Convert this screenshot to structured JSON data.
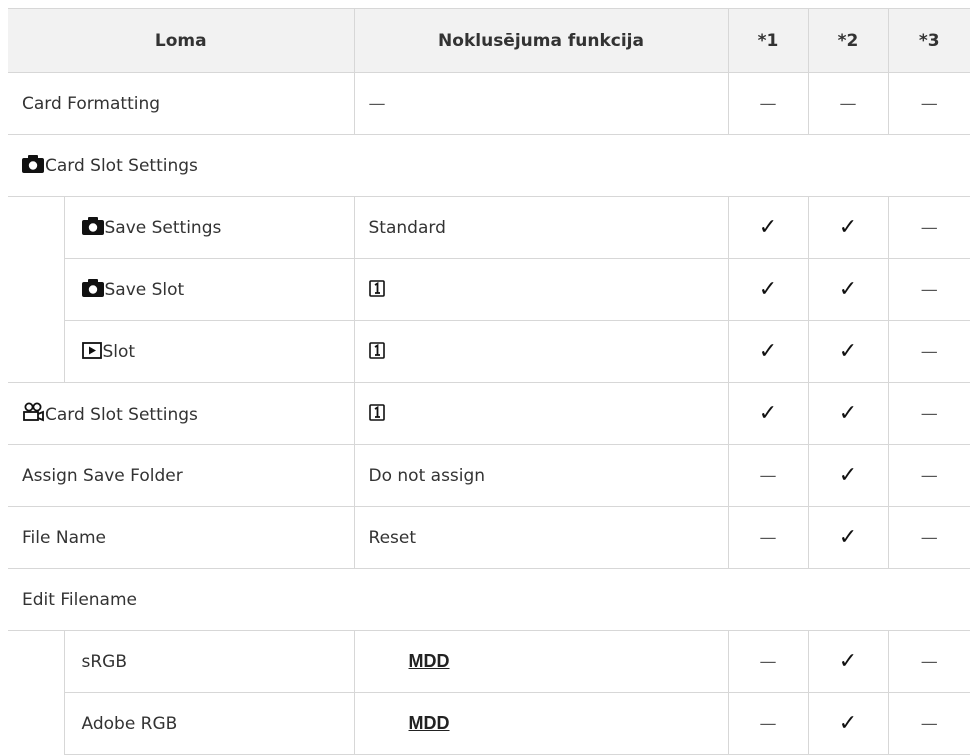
{
  "headers": [
    "Loma",
    "Noklusējuma funkcija",
    "*1",
    "*2",
    "*3"
  ],
  "rows": [
    {
      "label": "Card Formatting",
      "icon": "",
      "level": 0,
      "value": "—",
      "c1": "—",
      "c2": "—",
      "c3": "—"
    },
    {
      "label": "Card Slot Settings",
      "icon": "camera-icon",
      "level": 0,
      "section": true
    },
    {
      "label": "Save Settings",
      "icon": "camera-icon",
      "level": 1,
      "value": "Standard",
      "c1": "✓",
      "c2": "✓",
      "c3": "—"
    },
    {
      "label": "Save Slot",
      "icon": "camera-icon",
      "level": 1,
      "value": "card-slot-1-icon",
      "c1": "✓",
      "c2": "✓",
      "c3": "—"
    },
    {
      "label": "Slot",
      "icon": "playback-icon",
      "level": 1,
      "value": "card-slot-1-icon",
      "c1": "✓",
      "c2": "✓",
      "c3": "—"
    },
    {
      "label": "Card Slot Settings",
      "icon": "movie-icon",
      "level": 0,
      "value": "card-slot-1-icon",
      "c1": "✓",
      "c2": "✓",
      "c3": "—"
    },
    {
      "label": "Assign Save Folder",
      "icon": "",
      "level": 0,
      "value": "Do not assign",
      "c1": "—",
      "c2": "✓",
      "c3": "—"
    },
    {
      "label": "File Name",
      "icon": "",
      "level": 0,
      "value": "Reset",
      "c1": "—",
      "c2": "✓",
      "c3": "—"
    },
    {
      "label": "Edit Filename",
      "icon": "",
      "level": 0,
      "section": true
    },
    {
      "label": "sRGB",
      "icon": "",
      "level": 1,
      "value": "MDD",
      "c1": "—",
      "c2": "✓",
      "c3": "—"
    },
    {
      "label": "Adobe RGB",
      "icon": "",
      "level": 1,
      "value": "MDD",
      "c1": "—",
      "c2": "✓",
      "c3": "—"
    }
  ]
}
